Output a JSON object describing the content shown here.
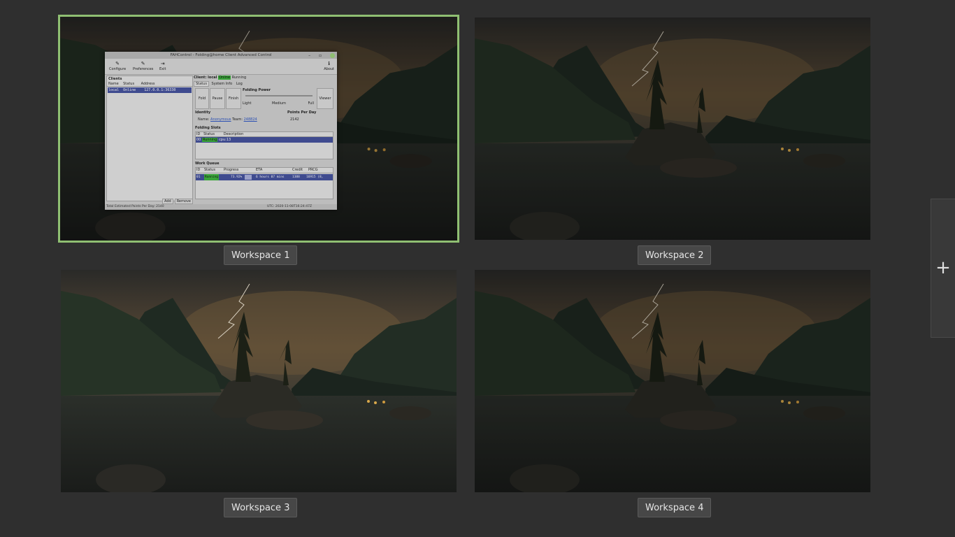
{
  "workspaces": [
    {
      "label": "Workspace 1",
      "active": true
    },
    {
      "label": "Workspace 2",
      "active": false
    },
    {
      "label": "Workspace 3",
      "active": false
    },
    {
      "label": "Workspace 4",
      "active": false
    }
  ],
  "add_workspace": {
    "icon": "plus-icon",
    "glyph": "+"
  },
  "app_window": {
    "title": "FAHControl - Folding@home Client Advanced Control",
    "toolbar": {
      "configure": "Configure",
      "preferences": "Preferences",
      "exit": "Exit",
      "about": "About"
    },
    "clients": {
      "heading": "Clients",
      "columns": [
        "Name",
        "Status",
        "Address"
      ],
      "row": {
        "name": "local",
        "status": "Online",
        "address": "127.0.0.1:36330"
      },
      "add": "Add",
      "remove": "Remove"
    },
    "client_header": {
      "prefix": "Client: local",
      "state": "Online",
      "running": "Running"
    },
    "tabs": [
      "Status",
      "System Info",
      "Log"
    ],
    "folding_buttons": {
      "fold": "Fold",
      "pause": "Pause",
      "finish": "Finish",
      "viewer": "Viewer"
    },
    "folding_power": {
      "label": "Folding Power",
      "light": "Light",
      "medium": "Medium",
      "full": "Full"
    },
    "identity": {
      "label": "Identity",
      "name_label": "Name:",
      "name": "Anonymous",
      "team_label": "Team:",
      "team": "248824"
    },
    "ppd": {
      "label": "Points Per Day",
      "value": "2142"
    },
    "folding_slots": {
      "label": "Folding Slots",
      "columns": [
        "ID",
        "Status",
        "Description"
      ],
      "row": {
        "id": "00",
        "status": "Running",
        "description": "cpu:13"
      }
    },
    "work_queue": {
      "label": "Work Queue",
      "columns": [
        "ID",
        "Status",
        "Progress",
        "ETA",
        "Credit",
        "PRCG"
      ],
      "row": {
        "id": "01",
        "status": "Running",
        "progress": "73.92%",
        "eta": "6 hours 07 mins",
        "credit": "1388",
        "prcg": "16915 (8,"
      }
    },
    "statusbar": {
      "left": "Total Estimated Points Per Day: 2140",
      "right": "UTC: 2020-11-08T16:24:47Z"
    }
  }
}
